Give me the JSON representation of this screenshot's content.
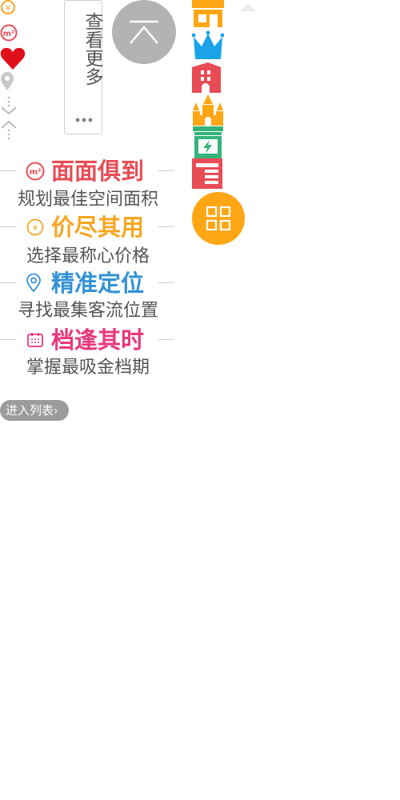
{
  "more_button": {
    "label": "查看更多"
  },
  "features": [
    {
      "title": "面面俱到",
      "subtitle": "规划最佳空间面积",
      "color": "#e84c55",
      "icon": "area-m2-icon"
    },
    {
      "title": "价尽其用",
      "subtitle": "选择最称心价格",
      "color": "#f6a623",
      "icon": "yen-price-icon"
    },
    {
      "title": "精准定位",
      "subtitle": "寻找最集客流位置",
      "color": "#3393d6",
      "icon": "location-pin-icon"
    },
    {
      "title": "档逢其时",
      "subtitle": "掌握最吸金档期",
      "color": "#e8387d",
      "icon": "calendar-icon"
    }
  ],
  "enter_list": {
    "label": "进入列表"
  },
  "colors": {
    "gray_button": "#b3b3b3",
    "orange": "#ffa614",
    "red": "#e84c55",
    "blue": "#1aa3e8",
    "green": "#34b47a"
  },
  "left_icons": [
    "yen-price-icon",
    "area-m2-icon",
    "heart-icon",
    "location-pin-icon",
    "scroll-down-icon",
    "scroll-up-icon"
  ],
  "category_icons": [
    "storefront-icon",
    "crown-icon",
    "building-icon",
    "castle-icon",
    "energy-shop-icon",
    "news-board-icon",
    "grid-menu-icon"
  ]
}
